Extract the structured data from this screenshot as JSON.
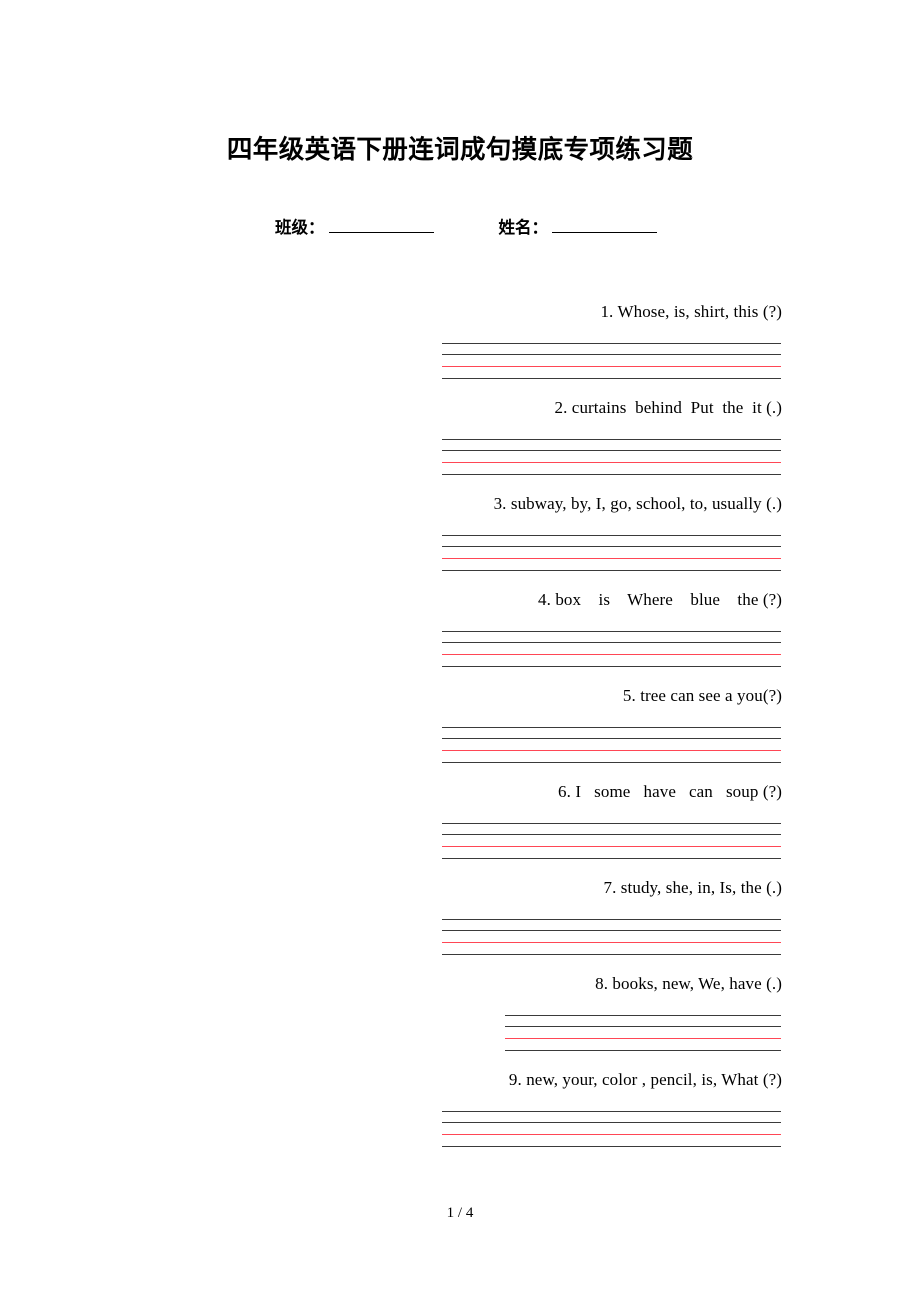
{
  "document": {
    "title": "四年级英语下册连词成句摸底专项练习题",
    "footer": "1 / 4"
  },
  "info": {
    "class_label": "班级：",
    "name_label": "姓名："
  },
  "colors": {
    "guide_line_black": "#3a3a3a",
    "guide_line_red": "#ff4655",
    "text": "#000000",
    "page_background": "#ffffff"
  },
  "questions": [
    {
      "number": "1.",
      "text": "1. Whose, is, shirt, this (?)",
      "guide_width": "wide"
    },
    {
      "number": "2.",
      "text": "2. curtains  behind  Put  the  it (.)",
      "guide_width": "wide"
    },
    {
      "number": "3.",
      "text": "3. subway, by, I, go, school, to, usually (.)",
      "guide_width": "wide"
    },
    {
      "number": "4.",
      "text": "4. box    is    Where    blue    the (?)",
      "guide_width": "wide"
    },
    {
      "number": "5.",
      "text": "5. tree can see a you(?)",
      "guide_width": "wide"
    },
    {
      "number": "6.",
      "text": "6. I   some   have   can   soup (?)",
      "guide_width": "wide"
    },
    {
      "number": "7.",
      "text": "7. study, she, in, Is, the (.)",
      "guide_width": "wide"
    },
    {
      "number": "8.",
      "text": "8. books, new, We, have (.)",
      "guide_width": "short"
    },
    {
      "number": "9.",
      "text": "9. new, your, color , pencil, is, What (?)",
      "guide_width": "wide"
    }
  ]
}
